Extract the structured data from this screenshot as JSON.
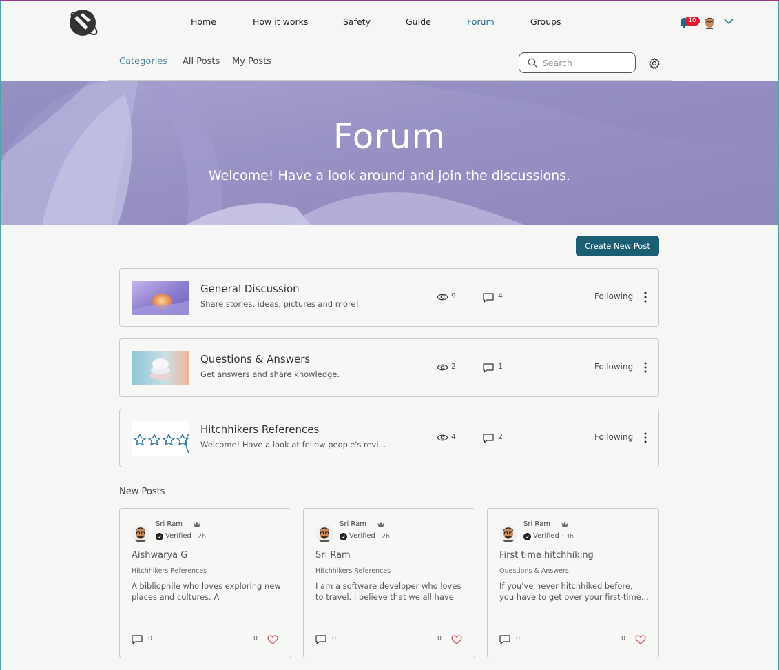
{
  "header": {
    "nav": [
      {
        "label": "Home",
        "active": false
      },
      {
        "label": "How it works",
        "active": false
      },
      {
        "label": "Safety",
        "active": false
      },
      {
        "label": "Guide",
        "active": false
      },
      {
        "label": "Forum",
        "active": true
      },
      {
        "label": "Groups",
        "active": false
      }
    ],
    "notifications_count": "10"
  },
  "subnav": {
    "items": [
      {
        "label": "Categories",
        "active": true
      },
      {
        "label": "All Posts",
        "active": false
      },
      {
        "label": "My Posts",
        "active": false
      }
    ],
    "search_placeholder": "Search"
  },
  "hero": {
    "title": "Forum",
    "subtitle": "Welcome! Have a look around and join the discussions."
  },
  "create_button": "Create New Post",
  "categories": [
    {
      "title": "General Discussion",
      "description": "Share stories, ideas, pictures and more!",
      "views": "9",
      "comments": "4",
      "follow_label": "Following",
      "thumb": "abstract-orange-purple"
    },
    {
      "title": "Questions & Answers",
      "description": "Get answers and share knowledge.",
      "views": "2",
      "comments": "1",
      "follow_label": "Following",
      "thumb": "abstract-stacked-discs"
    },
    {
      "title": "Hitchhikers References",
      "description": "Welcome! Have a look at fellow people's revi...",
      "views": "4",
      "comments": "2",
      "follow_label": "Following",
      "thumb": "star-rating"
    }
  ],
  "new_posts_heading": "New Posts",
  "posts": [
    {
      "author": "Sri Ram",
      "verified": "Verified",
      "time": "· 2h",
      "title": "Aishwarya G",
      "category": "Hitchhikers References",
      "excerpt": "A bibliophile who loves exploring new places and cultures. A management...",
      "comments": "0",
      "likes": "0"
    },
    {
      "author": "Sri Ram",
      "verified": "Verified",
      "time": "· 2h",
      "title": "Sri Ram",
      "category": "Hitchhikers References",
      "excerpt": "I am a software developer who loves to travel. I believe that we all have in...",
      "comments": "0",
      "likes": "0"
    },
    {
      "author": "Sri Ram",
      "verified": "Verified",
      "time": "· 3h",
      "title": "First time hitchhiking",
      "category": "Questions & Answers",
      "excerpt": "If you've never hitchhiked before, you have to get over your first-time...",
      "comments": "0",
      "likes": "0"
    }
  ],
  "colors": {
    "accent": "#1b5d72",
    "active_nav": "#1d6a89",
    "hero": "#9b94c5",
    "badge": "#e21a2c",
    "heart": "#e0565b"
  }
}
